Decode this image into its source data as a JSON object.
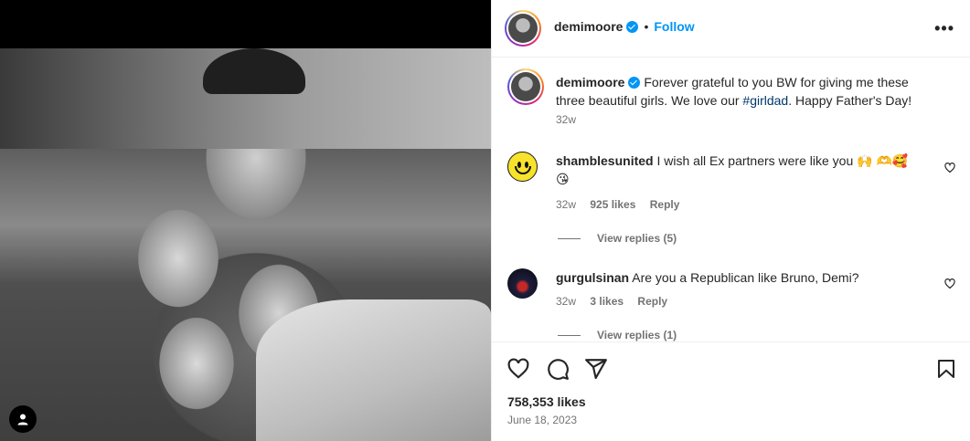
{
  "post": {
    "username": "demimoore",
    "follow_label": "Follow",
    "more_label": "•••",
    "caption": {
      "username": "demimoore",
      "text_before": "Forever grateful to you BW for giving me these three beautiful girls. We love our ",
      "hashtag": "#girldad",
      "text_after": ". Happy Father's Day!",
      "time": "32w"
    },
    "likes": "758,353 likes",
    "date": "June 18, 2023",
    "icons": [
      "heart-icon",
      "comment-icon",
      "share-icon",
      "save-icon",
      "more-icon",
      "user-tag-icon"
    ]
  },
  "comments": [
    {
      "username": "shamblesunited",
      "text": "I wish all Ex partners were like you 🙌 🫶🥰 😘",
      "time": "32w",
      "likes": "925 likes",
      "reply": "Reply",
      "view_replies": "View replies (5)"
    },
    {
      "username": "gurgulsinan",
      "text": "Are you a Republican like Bruno, Demi?",
      "time": "32w",
      "likes": "3 likes",
      "reply": "Reply",
      "view_replies": "View replies (1)"
    }
  ],
  "colors": {
    "accent": "#0095f6",
    "muted": "#737373",
    "text": "#262626",
    "hashtag": "#00376b"
  }
}
